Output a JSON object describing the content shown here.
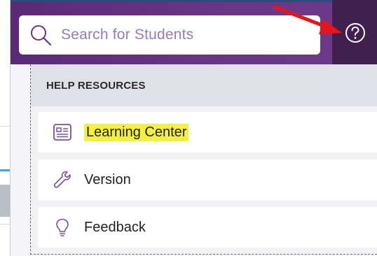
{
  "search": {
    "placeholder": "Search for Students",
    "icon": "search-icon"
  },
  "help": {
    "icon": "help-circle-icon"
  },
  "panel": {
    "title": "HELP RESOURCES",
    "items": [
      {
        "label": "Learning Center",
        "icon": "learning-center-icon",
        "highlighted": true
      },
      {
        "label": "Version",
        "icon": "wrench-icon",
        "highlighted": false
      },
      {
        "label": "Feedback",
        "icon": "lightbulb-icon",
        "highlighted": false
      }
    ]
  },
  "colors": {
    "header_purple": "#6a3586",
    "help_button": "#41204f",
    "placeholder": "#9a7ab8",
    "icon_purple": "#7a4fa0",
    "highlight": "#f4f040",
    "annotation_arrow": "#e8141b"
  }
}
